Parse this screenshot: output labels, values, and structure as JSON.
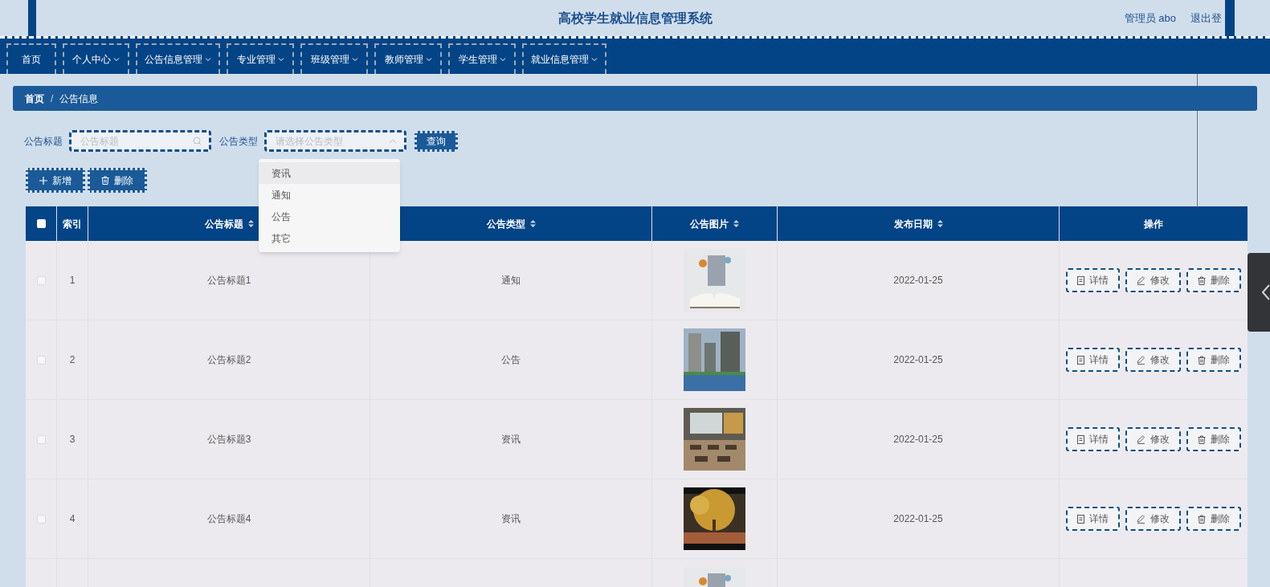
{
  "header": {
    "title": "高校学生就业信息管理系统",
    "user": "管理员 abo",
    "logout": "退出登"
  },
  "nav": [
    {
      "label": "首页",
      "dropdown": false
    },
    {
      "label": "个人中心",
      "dropdown": true
    },
    {
      "label": "公告信息管理",
      "dropdown": true
    },
    {
      "label": "专业管理",
      "dropdown": true
    },
    {
      "label": "班级管理",
      "dropdown": true
    },
    {
      "label": "教师管理",
      "dropdown": true
    },
    {
      "label": "学生管理",
      "dropdown": true
    },
    {
      "label": "就业信息管理",
      "dropdown": true
    }
  ],
  "breadcrumb": [
    "首页",
    "公告信息"
  ],
  "breadcrumb_separator": "/",
  "filters": [
    {
      "label": "公告标题",
      "placeholder": "公告标题",
      "kind": "search"
    },
    {
      "label": "公告类型",
      "placeholder": "请选择公告类型",
      "kind": "select",
      "expanded": true
    }
  ],
  "query_button": "查询",
  "actions": [
    {
      "label": "新增",
      "kind": "add"
    },
    {
      "label": "删除",
      "kind": "delete"
    }
  ],
  "dropdown_options": [
    {
      "label": "资讯",
      "highlighted": true
    },
    {
      "label": "通知",
      "highlighted": false
    },
    {
      "label": "公告",
      "highlighted": false
    },
    {
      "label": "其它",
      "highlighted": false
    }
  ],
  "table": {
    "select_all_checked": false,
    "columns": [
      {
        "label": "索引",
        "sortable": false
      },
      {
        "label": "公告标题",
        "sortable": true
      },
      {
        "label": "公告类型",
        "sortable": true
      },
      {
        "label": "公告图片",
        "sortable": true
      },
      {
        "label": "发布日期",
        "sortable": true
      },
      {
        "label": "操作",
        "sortable": false
      }
    ],
    "rows": [
      {
        "checked": false,
        "index": "1",
        "title": "公告标题1",
        "type": "通知",
        "date": "2022-01-25",
        "actions": [
          {
            "label": "详情",
            "kind": "detail"
          },
          {
            "label": "修改",
            "kind": "edit"
          },
          {
            "label": "删除",
            "kind": "delete"
          }
        ]
      },
      {
        "checked": false,
        "index": "2",
        "title": "公告标题2",
        "type": "公告",
        "date": "2022-01-25",
        "actions": [
          {
            "label": "详情",
            "kind": "detail"
          },
          {
            "label": "修改",
            "kind": "edit"
          },
          {
            "label": "删除",
            "kind": "delete"
          }
        ]
      },
      {
        "checked": false,
        "index": "3",
        "title": "公告标题3",
        "type": "资讯",
        "date": "2022-01-25",
        "actions": [
          {
            "label": "详情",
            "kind": "detail"
          },
          {
            "label": "修改",
            "kind": "edit"
          },
          {
            "label": "删除",
            "kind": "delete"
          }
        ]
      },
      {
        "checked": false,
        "index": "4",
        "title": "公告标题4",
        "type": "资讯",
        "date": "2022-01-25",
        "actions": [
          {
            "label": "详情",
            "kind": "detail"
          },
          {
            "label": "修改",
            "kind": "edit"
          },
          {
            "label": "删除",
            "kind": "delete"
          }
        ]
      },
      {
        "kind": "picture"
      }
    ]
  }
}
